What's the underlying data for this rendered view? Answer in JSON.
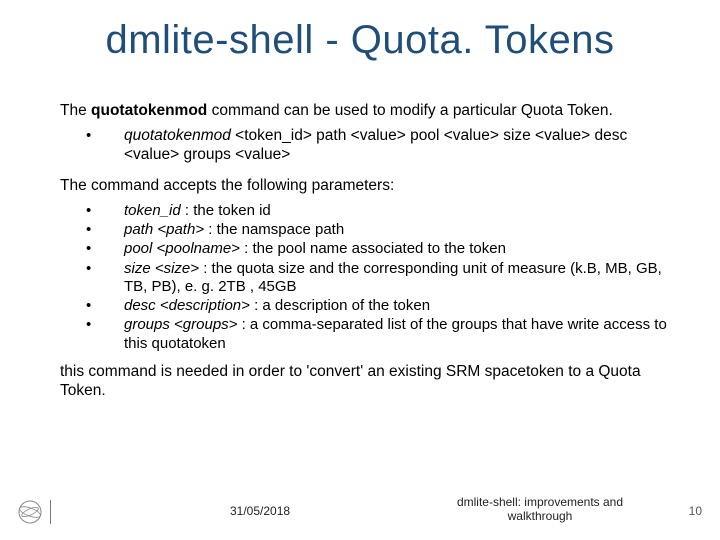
{
  "title": "dmlite-shell - Quota. Tokens",
  "intro": {
    "pre": "The ",
    "cmd": "quotatokenmod",
    "post": " command can be used to modify a particular Quota Token."
  },
  "usage": {
    "cmd": "quotatokenmod",
    "rest": " <token_id> path <value> pool <value> size <value> desc <value> groups <value>"
  },
  "params_heading": "The command accepts the following parameters:",
  "params": [
    {
      "key": "token_id",
      "desc": " : the token id"
    },
    {
      "key": "path <path>",
      "desc": " : the namspace path"
    },
    {
      "key": "pool <poolname>",
      "desc": " : the pool name associated to the token"
    },
    {
      "key": "size <size>",
      "desc": " : the quota size and the corresponding unit of measure (k.B, MB, GB, TB, PB), e. g. 2TB , 45GB"
    },
    {
      "key": "desc <description>",
      "desc": " : a description of the token"
    },
    {
      "key": "groups <groups>",
      "desc": " : a comma-separated list of the groups that have write access to this quotatoken"
    }
  ],
  "closing": "this command is needed in order to 'convert' an existing SRM spacetoken to a Quota Token.",
  "footer": {
    "date": "31/05/2018",
    "title": "dmlite-shell: improvements and walkthrough",
    "page": "10"
  }
}
